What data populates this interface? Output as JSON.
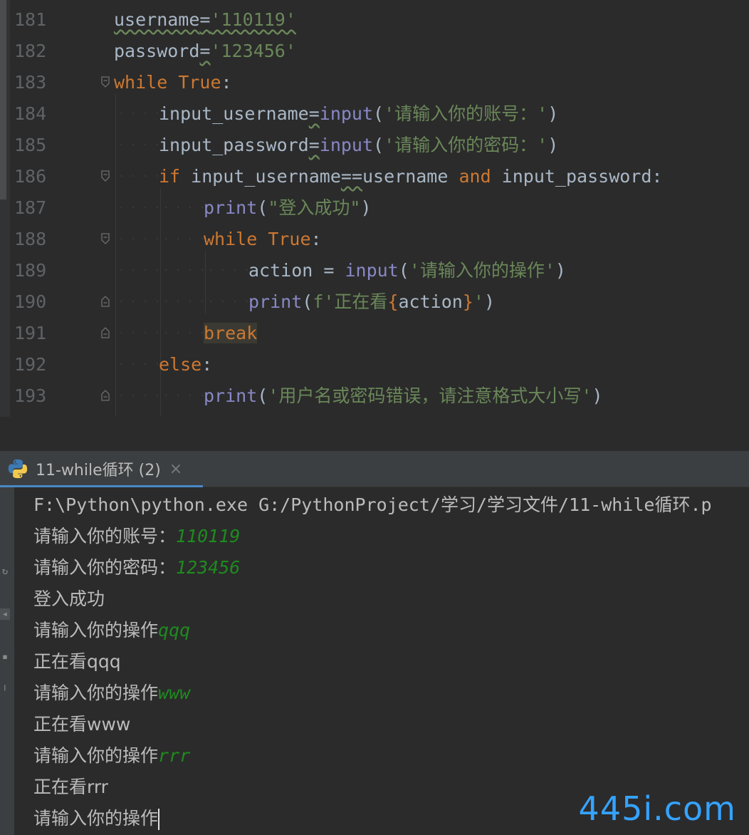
{
  "editor": {
    "lines": [
      {
        "num": "181",
        "segments": [
          {
            "t": "username",
            "c": "var",
            "sq": true
          },
          {
            "t": "=",
            "c": "var",
            "sq": true
          },
          {
            "t": "'110119'",
            "c": "str",
            "sq": true
          }
        ]
      },
      {
        "num": "182",
        "segments": [
          {
            "t": "password",
            "c": "var"
          },
          {
            "t": "=",
            "c": "var",
            "sq": true
          },
          {
            "t": "'123456'",
            "c": "str"
          }
        ]
      },
      {
        "num": "183",
        "fold": "open",
        "segments": [
          {
            "t": "while",
            "c": "kw"
          },
          {
            "t": " ",
            "c": "var"
          },
          {
            "t": "True",
            "c": "kw"
          },
          {
            "t": ":",
            "c": "var"
          }
        ]
      },
      {
        "num": "184",
        "indent": 1,
        "segments": [
          {
            "t": "input_username",
            "c": "var"
          },
          {
            "t": "=",
            "c": "var",
            "sq": true
          },
          {
            "t": "input",
            "c": "fn"
          },
          {
            "t": "(",
            "c": "var"
          },
          {
            "t": "'请输入你的账号：'",
            "c": "str"
          },
          {
            "t": ")",
            "c": "var"
          }
        ]
      },
      {
        "num": "185",
        "indent": 1,
        "segments": [
          {
            "t": "input_password",
            "c": "var"
          },
          {
            "t": "=",
            "c": "var",
            "sq": true
          },
          {
            "t": "input",
            "c": "fn"
          },
          {
            "t": "(",
            "c": "var"
          },
          {
            "t": "'请输入你的密码：'",
            "c": "str"
          },
          {
            "t": ")",
            "c": "var"
          }
        ]
      },
      {
        "num": "186",
        "indent": 1,
        "fold": "open",
        "segments": [
          {
            "t": "if",
            "c": "kw"
          },
          {
            "t": " input_username",
            "c": "var"
          },
          {
            "t": "==",
            "c": "var",
            "sq": true
          },
          {
            "t": "username ",
            "c": "var"
          },
          {
            "t": "and",
            "c": "kw"
          },
          {
            "t": " input_password:",
            "c": "var"
          }
        ]
      },
      {
        "num": "187",
        "indent": 2,
        "segments": [
          {
            "t": "print",
            "c": "fn"
          },
          {
            "t": "(",
            "c": "var"
          },
          {
            "t": "\"登入成功\"",
            "c": "str"
          },
          {
            "t": ")",
            "c": "var"
          }
        ]
      },
      {
        "num": "188",
        "indent": 2,
        "fold": "open",
        "segments": [
          {
            "t": "while",
            "c": "kw"
          },
          {
            "t": " ",
            "c": "var"
          },
          {
            "t": "True",
            "c": "kw"
          },
          {
            "t": ":",
            "c": "var"
          }
        ]
      },
      {
        "num": "189",
        "indent": 3,
        "segments": [
          {
            "t": "action = ",
            "c": "var"
          },
          {
            "t": "input",
            "c": "fn"
          },
          {
            "t": "(",
            "c": "var"
          },
          {
            "t": "'请输入你的操作'",
            "c": "str"
          },
          {
            "t": ")",
            "c": "var"
          }
        ]
      },
      {
        "num": "190",
        "indent": 3,
        "fold": "end",
        "segments": [
          {
            "t": "print",
            "c": "fn"
          },
          {
            "t": "(",
            "c": "var"
          },
          {
            "t": "f'正在看",
            "c": "str"
          },
          {
            "t": "{",
            "c": "brace"
          },
          {
            "t": "action",
            "c": "fvar"
          },
          {
            "t": "}",
            "c": "brace"
          },
          {
            "t": "'",
            "c": "str"
          },
          {
            "t": ")",
            "c": "var"
          }
        ]
      },
      {
        "num": "191",
        "indent": 2,
        "fold": "end",
        "segments": [
          {
            "t": "break",
            "c": "kw",
            "hl": true
          }
        ]
      },
      {
        "num": "192",
        "indent": 1,
        "segments": [
          {
            "t": "else",
            "c": "kw"
          },
          {
            "t": ":",
            "c": "var"
          }
        ]
      },
      {
        "num": "193",
        "indent": 2,
        "fold": "end",
        "segments": [
          {
            "t": "print",
            "c": "fn"
          },
          {
            "t": "(",
            "c": "var"
          },
          {
            "t": "'用户名或密码错误，请注意格式大小写'",
            "c": "str"
          },
          {
            "t": ")",
            "c": "var"
          }
        ]
      }
    ]
  },
  "run_panel": {
    "tab_label": "11-while循环 (2)",
    "tab_close": "×",
    "python_icon": "python-logo-icon",
    "console_lines": [
      {
        "text": "F:\\Python\\python.exe G:/PythonProject/学习/学习文件/11-while循环.p",
        "input": ""
      },
      {
        "text": "请输入你的账号：",
        "input": "110119"
      },
      {
        "text": "请输入你的密码：",
        "input": "123456"
      },
      {
        "text": "登入成功",
        "input": ""
      },
      {
        "text": "请输入你的操作",
        "input": "qqq"
      },
      {
        "text": "正在看qqq",
        "input": ""
      },
      {
        "text": "请输入你的操作",
        "input": "www"
      },
      {
        "text": "正在看www",
        "input": ""
      },
      {
        "text": "请输入你的操作",
        "input": "rrr"
      },
      {
        "text": "正在看rrr",
        "input": ""
      },
      {
        "text": "请输入你的操作",
        "input": "",
        "cursor": true
      }
    ]
  },
  "watermark": "445i.com",
  "colors": {
    "keyword": "#cc7832",
    "string": "#6a8759",
    "builtin": "#8888c6",
    "identifier": "#a9b7c6",
    "console_input": "#1f8a1f",
    "tab_accent": "#4a88c7"
  }
}
